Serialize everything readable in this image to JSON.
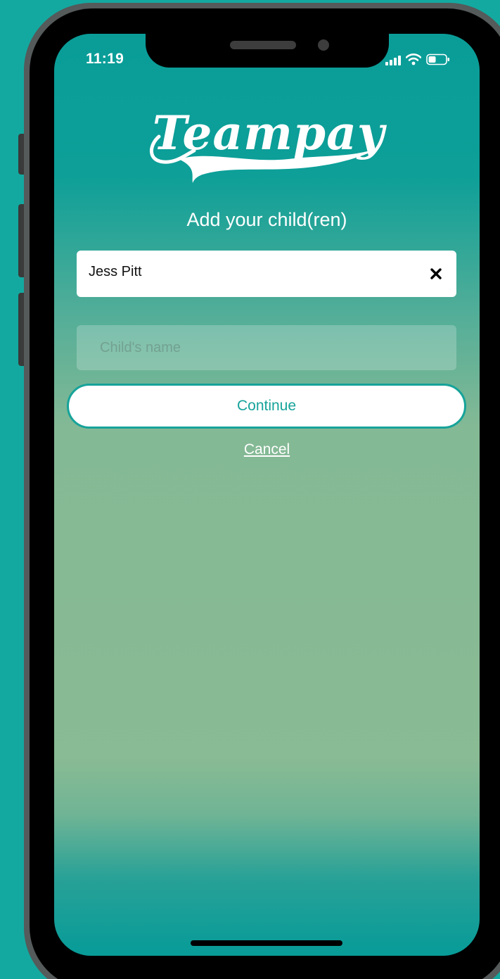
{
  "status_bar": {
    "time": "11:19",
    "signal_icon": "cellular-signal-icon",
    "wifi_icon": "wifi-icon",
    "battery_icon": "battery-icon"
  },
  "brand": {
    "logo_text": "Teampay"
  },
  "page": {
    "heading": "Add your child(ren)"
  },
  "children": [
    {
      "name": "Jess Pitt",
      "remove_icon": "close-icon"
    }
  ],
  "name_input": {
    "placeholder": "Child's name",
    "value": ""
  },
  "actions": {
    "continue_label": "Continue",
    "cancel_label": "Cancel"
  },
  "colors": {
    "accent": "#16a39a",
    "background": "#14a9a0"
  }
}
